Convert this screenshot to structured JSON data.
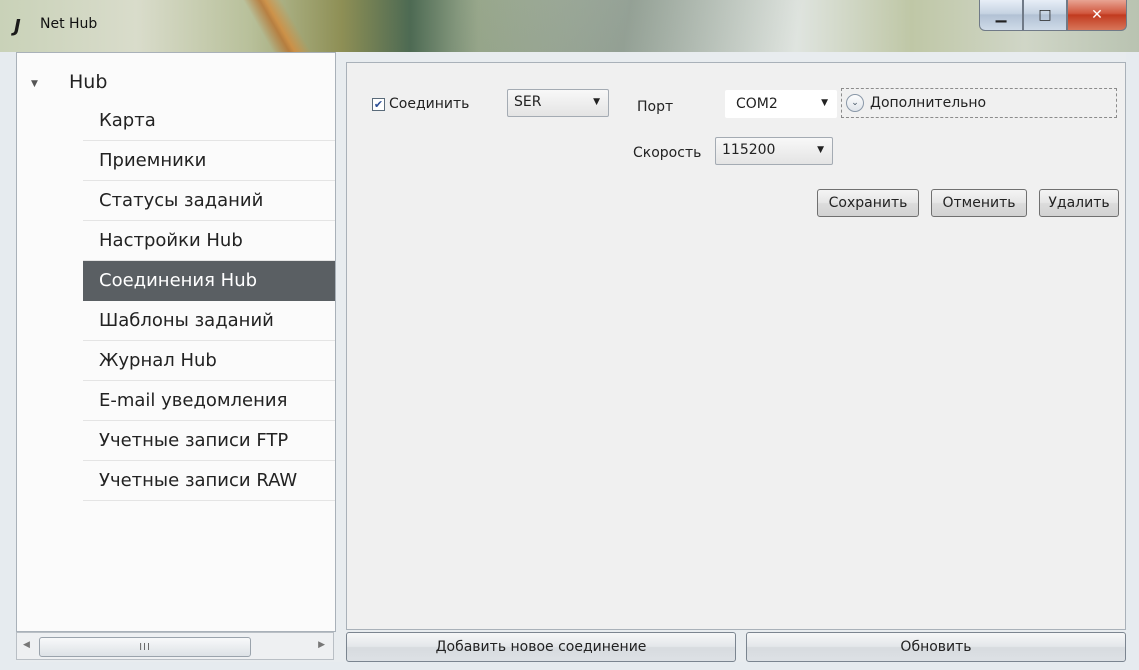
{
  "window": {
    "title": "Net Hub",
    "app_icon": "app-logo-icon",
    "controls": {
      "minimize": "minimize-icon",
      "maximize": "maximize-icon",
      "close": "close-icon"
    }
  },
  "nav": {
    "root_label": "Hub",
    "items": [
      {
        "label": "Карта"
      },
      {
        "label": "Приемники"
      },
      {
        "label": "Статусы заданий"
      },
      {
        "label": "Настройки Hub"
      },
      {
        "label": "Соединения Hub",
        "selected": true
      },
      {
        "label": "Шаблоны заданий"
      },
      {
        "label": "Журнал Hub"
      },
      {
        "label": "E-mail уведомления"
      },
      {
        "label": "Учетные записи FTP"
      },
      {
        "label": "Учетные записи RAW"
      }
    ],
    "scroll_grip": "III"
  },
  "connection": {
    "connect_label": "Соединить",
    "connect_checked": true,
    "type_value": "SER",
    "port_label": "Порт",
    "port_value": "COM2",
    "speed_label": "Скорость",
    "speed_value": "115200",
    "advanced_label": "Дополнительно"
  },
  "actions": {
    "save": "Сохранить",
    "cancel": "Отменить",
    "delete": "Удалить"
  },
  "footer": {
    "add_connection": "Добавить новое соединение",
    "refresh": "Обновить"
  },
  "colors": {
    "selected_bg": "#5a5f63",
    "check_mark": "#2c4e96",
    "close_button": "#c13a1f"
  }
}
